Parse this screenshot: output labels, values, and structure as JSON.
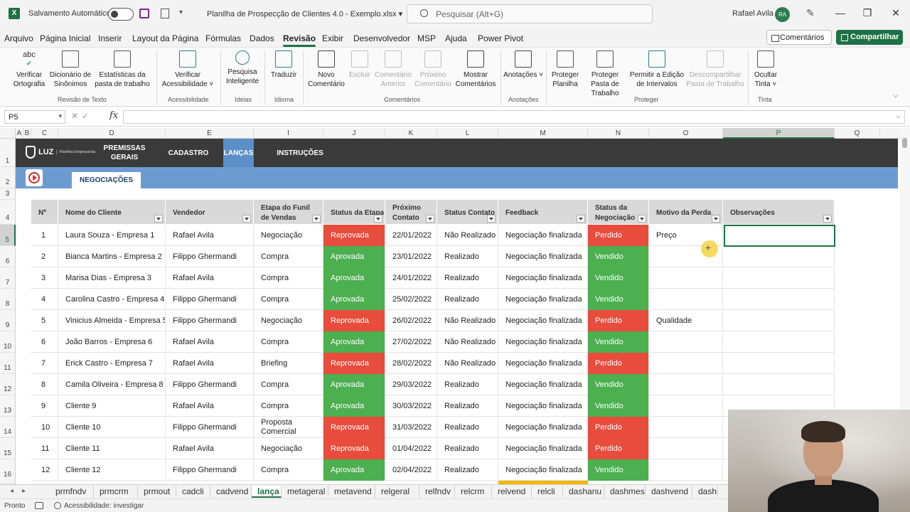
{
  "titlebar": {
    "autosave_label": "Salvamento Automático",
    "file_title": "Planilha de Prospecção de Clientes 4.0 - Exemplo.xlsx",
    "search_placeholder": "Pesquisar (Alt+G)",
    "user_name": "Rafael Avila",
    "user_initials": "RA"
  },
  "menu": [
    "Arquivo",
    "Página Inicial",
    "Inserir",
    "Layout da Página",
    "Fórmulas",
    "Dados",
    "Revisão",
    "Exibir",
    "Desenvolvedor",
    "MSP",
    "Ajuda",
    "Power Pivot"
  ],
  "menu_active": "Revisão",
  "menu_right": {
    "comments": "Comentários",
    "share": "Compartilhar"
  },
  "ribbon": {
    "buttons": {
      "spelling": "Verificar Ortografia",
      "spelling_top": "abc",
      "thesaurus": "Dicionário de Sinônimos",
      "stats": "Estatísticas da pasta de trabalho",
      "accessibility": "Verificar Acessibilidade ˅",
      "smart_lookup": "Pesquisa Inteligente",
      "translate": "Traduzir",
      "new_comment": "Novo Comentário",
      "delete": "Excluir",
      "prev_comment": "Comentário Anterior",
      "next_comment": "Próximo Comentário",
      "show_comments": "Mostrar Comentários",
      "notes": "Anotações ˅",
      "protect_sheet": "Proteger Planilha",
      "protect_workbook": "Proteger Pasta de Trabalho",
      "allow_edit": "Permitir a Edição de Intervalos",
      "unshare": "Descompartilhar Pasta de Trabalho",
      "hide_ink": "Ocultar Tinta ˅"
    },
    "groups": {
      "proofing": "Revisão de Texto",
      "accessibility": "Acessibilidade",
      "insights": "Ideias",
      "language": "Idioma",
      "comments": "Comentários",
      "notes": "Anotações",
      "protect": "Proteger",
      "ink": "Tinta"
    }
  },
  "formula_bar": {
    "name_box": "P5",
    "fx": "fx",
    "value": ""
  },
  "columns": [
    "A",
    "B",
    "C",
    "D",
    "E",
    "I",
    "J",
    "K",
    "L",
    "M",
    "N",
    "O",
    "P",
    "Q"
  ],
  "selected_column": "P",
  "rows": [
    "1",
    "2",
    "3",
    "4",
    "5",
    "6",
    "7",
    "8",
    "9",
    "10",
    "11",
    "12",
    "13",
    "14",
    "15",
    "16"
  ],
  "selected_row": "5",
  "nav": {
    "logo": "LUZ",
    "logo_sub": "Planilhas Empresariais",
    "tabs": [
      "PREMISSAS GERAIS",
      "CADASTRO",
      "LANÇAMENTOS",
      "INSTRUÇÕES"
    ],
    "tabs_visible": [
      "PREMISSAS\nGERAIS",
      "CADASTRO",
      "LANÇAS",
      "INSTRUÇÕES"
    ],
    "subtab": "NEGOCIAÇÕES"
  },
  "table": {
    "headers": [
      "Nº",
      "Nome do Cliente",
      "Vendedor",
      "Etapa do Funil de Vendas",
      "Status da Etapa",
      "Próximo Contato",
      "Status Contato",
      "Feedback",
      "Status da Negociação",
      "Motivo da Perda",
      "Observações"
    ],
    "headers_visible": [
      "Nº",
      "Nome do Cliente",
      "Vendedor",
      "Etapa do Funil de Vendas",
      "Status da Etapa",
      "Próximo Contato",
      "Status Contato",
      "Feedback",
      "Status da Negociação",
      "Motivo da Perda",
      "Observações"
    ],
    "rows": [
      [
        "1",
        "Laura Souza - Empresa 1",
        "Rafael Avila",
        "Negociação",
        "Reprovada",
        "22/01/2022",
        "Não Realizado",
        "Negociação finalizada",
        "Perdido",
        "Preço",
        ""
      ],
      [
        "2",
        "Bianca Martins - Empresa 2",
        "Filippo Ghermandi",
        "Compra",
        "Aprovada",
        "23/01/2022",
        "Realizado",
        "Negociação finalizada",
        "Vendido",
        "",
        ""
      ],
      [
        "3",
        "Marisa Dias - Empresa 3",
        "Rafael Avila",
        "Compra",
        "Aprovada",
        "24/01/2022",
        "Realizado",
        "Negociação finalizada",
        "Vendido",
        "",
        ""
      ],
      [
        "4",
        "Carolina Castro - Empresa 4",
        "Filippo Ghermandi",
        "Compra",
        "Aprovada",
        "25/02/2022",
        "Realizado",
        "Negociação finalizada",
        "Vendido",
        "",
        ""
      ],
      [
        "5",
        "Vinicius Almeida - Empresa 5",
        "Filippo Ghermandi",
        "Negociação",
        "Reprovada",
        "26/02/2022",
        "Não Realizado",
        "Negociação finalizada",
        "Perdido",
        "Qualidade",
        ""
      ],
      [
        "6",
        "João Barros - Empresa 6",
        "Rafael Avila",
        "Compra",
        "Aprovada",
        "27/02/2022",
        "Não Realizado",
        "Negociação finalizada",
        "Vendido",
        "",
        ""
      ],
      [
        "7",
        "Erick Castro - Empresa 7",
        "Rafael Avila",
        "Briefing",
        "Reprovada",
        "28/02/2022",
        "Não Realizado",
        "Negociação finalizada",
        "Perdido",
        "",
        ""
      ],
      [
        "8",
        "Camila Oliveira - Empresa 8",
        "Filippo Ghermandi",
        "Compra",
        "Aprovada",
        "29/03/2022",
        "Realizado",
        "Negociação finalizada",
        "Vendido",
        "",
        ""
      ],
      [
        "9",
        "Cliente 9",
        "Rafael Avila",
        "Compra",
        "Aprovada",
        "30/03/2022",
        "Realizado",
        "Negociação finalizada",
        "Vendido",
        "",
        ""
      ],
      [
        "10",
        "Cliente 10",
        "Filippo Ghermandi",
        "Proposta Comercial",
        "Reprovada",
        "31/03/2022",
        "Realizado",
        "Negociação finalizada",
        "Perdido",
        "",
        ""
      ],
      [
        "11",
        "Cliente 11",
        "Rafael Avila",
        "Negociação",
        "Reprovada",
        "01/04/2022",
        "Realizado",
        "Negociação finalizada",
        "Perdido",
        "",
        ""
      ],
      [
        "12",
        "Cliente 12",
        "Filippo Ghermandi",
        "Compra",
        "Aprovada",
        "02/04/2022",
        "Realizado",
        "Negociação finalizada",
        "Vendido",
        "",
        ""
      ]
    ]
  },
  "sheets": [
    "prmfndv",
    "prmcrm",
    "prmout",
    "cadcli",
    "cadvend",
    "lança",
    "metageral",
    "metavend",
    "relgeral",
    "relfndv",
    "relcrm",
    "relvend",
    "relcli",
    "dashanu",
    "dashmes",
    "dashvend",
    "dash"
  ],
  "active_sheet": "lança",
  "status": {
    "ready": "Pronto",
    "accessibility": "Acessibilidade: investigar"
  },
  "colors": {
    "accent": "#1e7145",
    "approved": "#4caf50",
    "rejected": "#e74c3c",
    "nav_dark": "#3a3a3a",
    "nav_blue": "#6c9bd0"
  }
}
